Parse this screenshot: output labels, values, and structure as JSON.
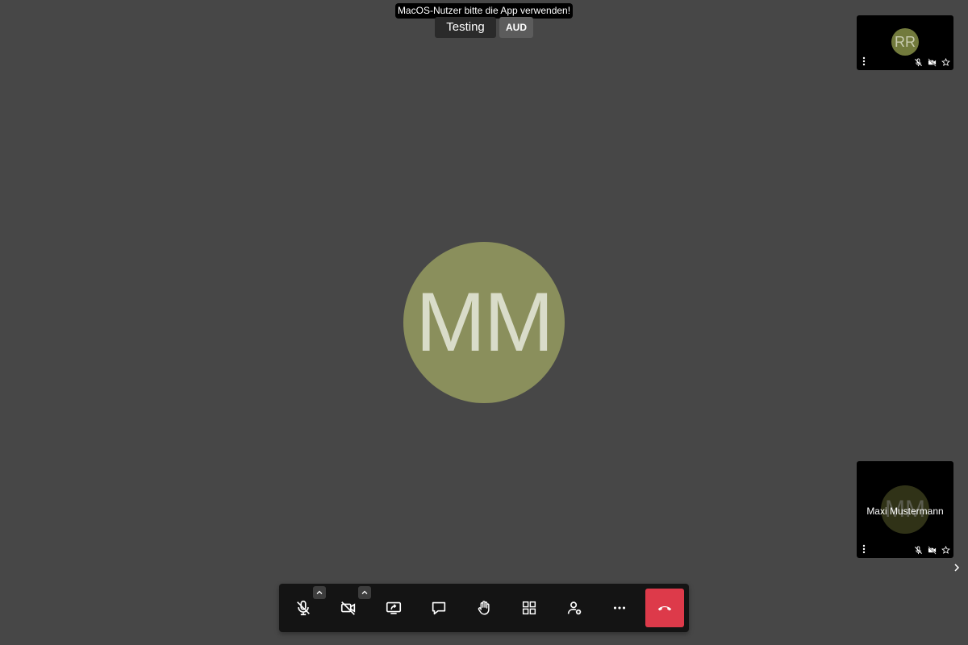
{
  "notice": {
    "text": "MacOS-Nutzer bitte die App verwenden!"
  },
  "header": {
    "title": "Testing",
    "quality_badge": "AUD"
  },
  "main": {
    "avatar_initials": "MM",
    "avatar_color": "#8a8f5c"
  },
  "thumbnails": [
    {
      "initials": "RR",
      "avatar_color": "#727a3c",
      "name": "",
      "icons": [
        "more-vertical-icon",
        "microphone-off-icon",
        "camera-off-icon",
        "star-icon"
      ]
    },
    {
      "initials": "MM",
      "avatar_color": "#6b7033",
      "name": "Maxi Mustermann",
      "icons": [
        "more-vertical-icon",
        "microphone-off-icon",
        "camera-off-icon",
        "star-icon"
      ]
    }
  ],
  "toolbar": {
    "buttons": [
      "microphone-off-icon",
      "camera-off-icon",
      "screen-share-icon",
      "chat-icon",
      "raise-hand-icon",
      "tile-view-icon",
      "participants-icon",
      "more-horizontal-icon",
      "hang-up-icon"
    ],
    "hangup_color": "#dd3a4a"
  },
  "colors": {
    "background": "#474747",
    "toolbar": "#141414"
  }
}
